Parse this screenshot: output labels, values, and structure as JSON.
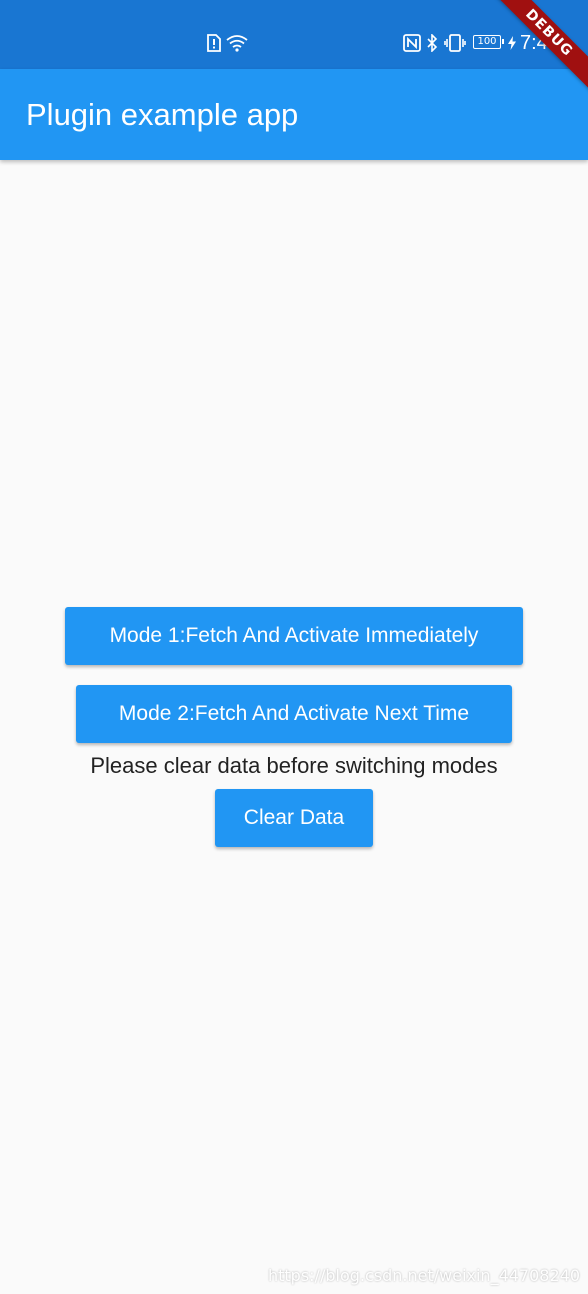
{
  "status_bar": {
    "icons": [
      "sim-alert-icon",
      "wifi-icon",
      "nfc-icon",
      "bluetooth-icon",
      "vibrate-icon",
      "charging-icon"
    ],
    "battery": "100",
    "time": "7:46"
  },
  "debug_banner": "DEBUG",
  "app_bar": {
    "title": "Plugin example app"
  },
  "main": {
    "mode1_label": "Mode 1:Fetch And Activate Immediately",
    "mode2_label": "Mode 2:Fetch And Activate Next Time",
    "hint": "Please clear data before switching modes",
    "clear_label": "Clear Data"
  },
  "watermark": "https://blog.csdn.net/weixin_44708240",
  "colors": {
    "status_bar": "#1976d2",
    "primary": "#2196f3",
    "background": "#fafafa",
    "debug_ribbon": "#a01010"
  }
}
